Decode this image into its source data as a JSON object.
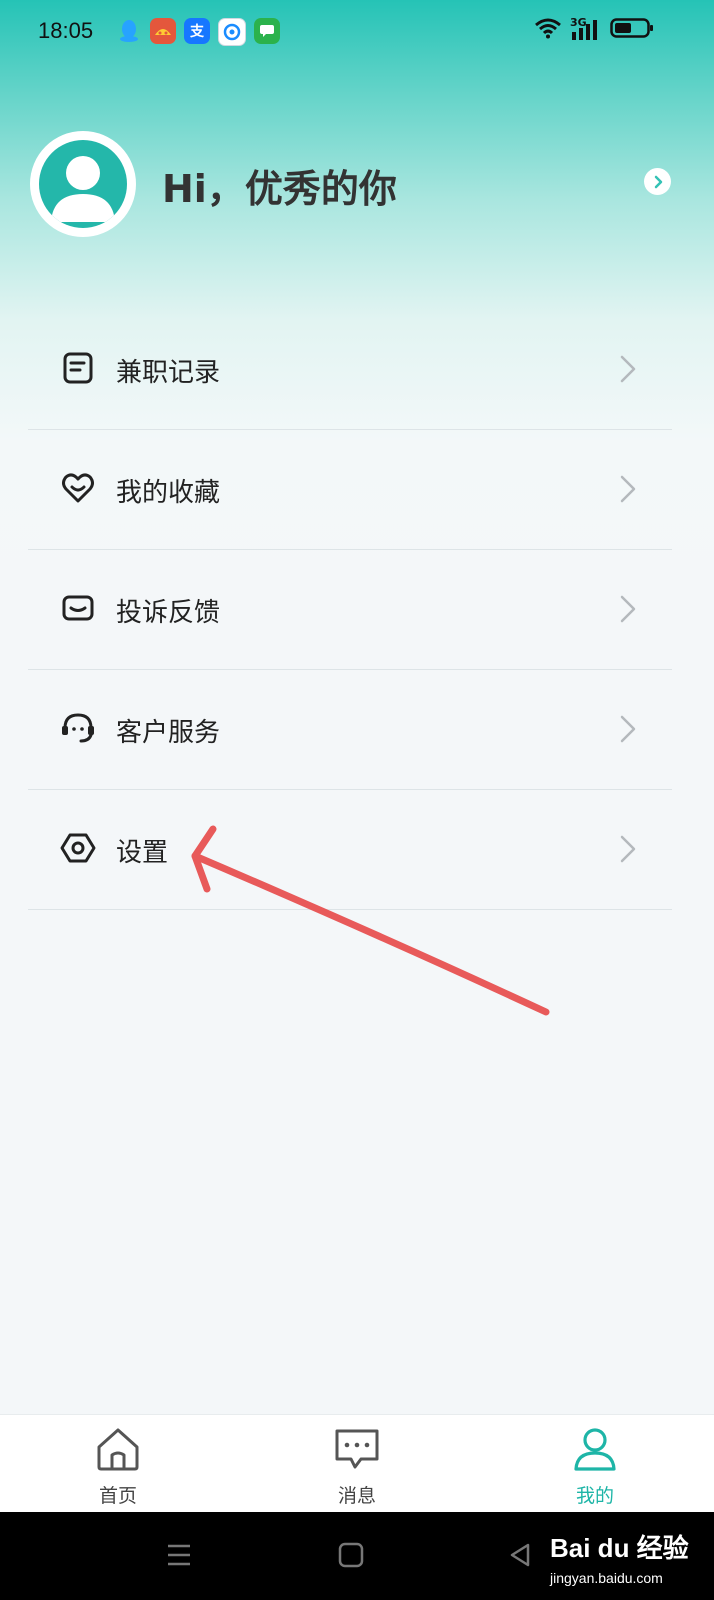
{
  "status_bar": {
    "time": "18:05",
    "network": "3G",
    "notification_icons": [
      "qq-icon",
      "app-red-icon",
      "alipay-icon",
      "mail-icon",
      "message-icon"
    ],
    "alipay_glyph": "支"
  },
  "profile": {
    "greeting": "Hi，优秀的你"
  },
  "menu": {
    "items": [
      {
        "label": "兼职记录",
        "icon": "record-icon"
      },
      {
        "label": "我的收藏",
        "icon": "heart-icon"
      },
      {
        "label": "投诉反馈",
        "icon": "feedback-icon"
      },
      {
        "label": "客户服务",
        "icon": "headset-icon"
      },
      {
        "label": "设置",
        "icon": "settings-icon"
      }
    ]
  },
  "tab_bar": {
    "tabs": [
      {
        "label": "首页",
        "icon": "home-icon",
        "active": false
      },
      {
        "label": "消息",
        "icon": "message-icon",
        "active": false
      },
      {
        "label": "我的",
        "icon": "profile-icon",
        "active": true
      }
    ]
  },
  "watermark": {
    "brand": "Bai du 经验",
    "url": "jingyan.baidu.com"
  },
  "colors": {
    "accent": "#1eb5a7",
    "annotation_arrow": "#e85a5a",
    "header_top": "#25c3b6"
  }
}
